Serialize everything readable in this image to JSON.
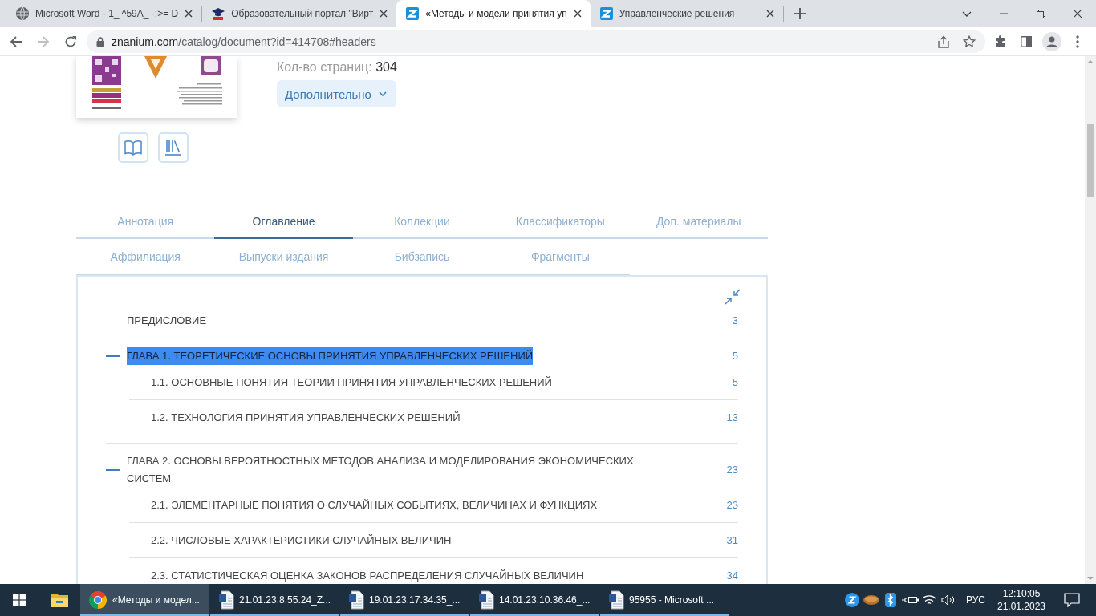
{
  "browser": {
    "tabs": [
      {
        "kind": "globe",
        "title": "Microsoft Word - 1_ ^59A_ -:>= D",
        "selected": false
      },
      {
        "kind": "portal",
        "title": "Образовательный портал \"Вирт",
        "selected": false
      },
      {
        "kind": "znanium",
        "title": "«Методы и модели принятия уп",
        "selected": true
      },
      {
        "kind": "znanium",
        "title": "Управленческие решения",
        "selected": false
      }
    ],
    "url_host": "znanium.com",
    "url_path": "/catalog/document?id=414708#headers"
  },
  "book": {
    "pages_label": "Кол-во страниц:",
    "pages_value": "304",
    "more_button": "Дополнительно"
  },
  "tab_rows": [
    {
      "tabs": [
        {
          "label": "Аннотация",
          "selected": false
        },
        {
          "label": "Оглавление",
          "selected": true
        },
        {
          "label": "Коллекции",
          "selected": false
        },
        {
          "label": "Классификаторы",
          "selected": false
        },
        {
          "label": "Доп. материалы",
          "selected": false
        }
      ]
    },
    {
      "tabs": [
        {
          "label": "Аффилиация",
          "selected": false
        },
        {
          "label": "Выпуски издания",
          "selected": false
        },
        {
          "label": "Бибзапись",
          "selected": false
        },
        {
          "label": "Фрагменты",
          "selected": false
        }
      ]
    }
  ],
  "contents": {
    "items": [
      {
        "kind": "section",
        "title": "ПРЕДИСЛОВИЕ",
        "page": "3",
        "highlighted": false
      },
      {
        "kind": "chapter",
        "title": "ГЛАВА 1. ТЕОРЕТИЧЕСКИЕ ОСНОВЫ ПРИНЯТИЯ УПРАВЛЕНЧЕСКИХ РЕШЕНИЙ",
        "page": "5",
        "highlighted": true,
        "expanded": true,
        "children": [
          {
            "title": "1.1. ОСНОВНЫЕ ПОНЯТИЯ ТЕОРИИ ПРИНЯТИЯ УПРАВЛЕНЧЕСКИХ РЕШЕНИЙ",
            "page": "5"
          },
          {
            "title": "1.2. ТЕХНОЛОГИЯ ПРИНЯТИЯ УПРАВЛЕНЧЕСКИХ РЕШЕНИЙ",
            "page": "13"
          }
        ]
      },
      {
        "kind": "chapter",
        "title": "ГЛАВА 2. ОСНОВЫ ВЕРОЯТНОСТНЫХ МЕТОДОВ АНАЛИЗА И МОДЕЛИРОВАНИЯ ЭКОНОМИЧЕСКИХ СИСТЕМ",
        "page": "23",
        "highlighted": false,
        "expanded": true,
        "children": [
          {
            "title": "2.1. ЭЛЕМЕНТАРНЫЕ ПОНЯТИЯ О СЛУЧАЙНЫХ СОБЫТИЯХ, ВЕЛИЧИНАХ И ФУНКЦИЯХ",
            "page": "23"
          },
          {
            "title": "2.2. ЧИСЛОВЫЕ ХАРАКТЕРИСТИКИ СЛУЧАЙНЫХ ВЕЛИЧИН",
            "page": "31"
          },
          {
            "title": "2.3. СТАТИСТИЧЕСКАЯ ОЦЕНКА ЗАКОНОВ РАСПРЕДЕЛЕНИЯ СЛУЧАЙНЫХ ВЕЛИЧИН",
            "page": "34"
          }
        ]
      }
    ]
  },
  "taskbar": {
    "apps": [
      {
        "kind": "browser",
        "label": "«Методы и модел...",
        "selected": true
      },
      {
        "kind": "document",
        "label": "21.01.23.8.55.24_Z...",
        "selected": false
      },
      {
        "kind": "document",
        "label": "19.01.23.17.34.35_...",
        "selected": false
      },
      {
        "kind": "document",
        "label": "14.01.23.10.36.46_...",
        "selected": false
      },
      {
        "kind": "document",
        "label": "95955 - Microsoft ...",
        "selected": false
      }
    ],
    "language": "РУС",
    "time": "12:10:05",
    "date": "21.01.2023"
  }
}
